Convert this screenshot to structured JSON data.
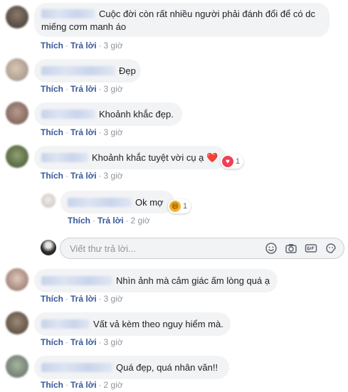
{
  "actions": {
    "like": "Thích",
    "reply": "Trả lời",
    "separator": "·"
  },
  "comments": [
    {
      "text_line1": "Cuộc đời còn rất nhiều người phải đánh đổi để có dc",
      "text_line2": "miếng cơm manh áo",
      "time": "3 giờ"
    },
    {
      "text": "Đẹp",
      "time": "3 giờ"
    },
    {
      "text": "Khoảnh khắc đẹp.",
      "time": "3 giờ"
    },
    {
      "text": "Khoảnh khắc tuyệt vời cụ ạ ❤️",
      "time": "3 giờ",
      "reaction": {
        "icon": "love-icon",
        "count": "1",
        "color": "#f33e58"
      }
    },
    {
      "text": "Nhìn ảnh mà cảm giác ấm lòng quá ạ",
      "time": "3 giờ"
    },
    {
      "text": "Vất vả kèm theo nguy hiểm mà.",
      "time": "3 giờ"
    },
    {
      "text": "Quá đẹp, quá nhân văn!!",
      "time": "2 giờ"
    }
  ],
  "reply": {
    "text": "Ok mợ",
    "time": "2 giờ",
    "reaction": {
      "icon": "haha-icon",
      "count": "1",
      "color": "#f7b125"
    }
  },
  "reply_input": {
    "placeholder": "Viết thư trả lời..."
  },
  "colors": {
    "link": "#385898",
    "meta": "#90949c",
    "bubble": "#f2f3f5"
  }
}
